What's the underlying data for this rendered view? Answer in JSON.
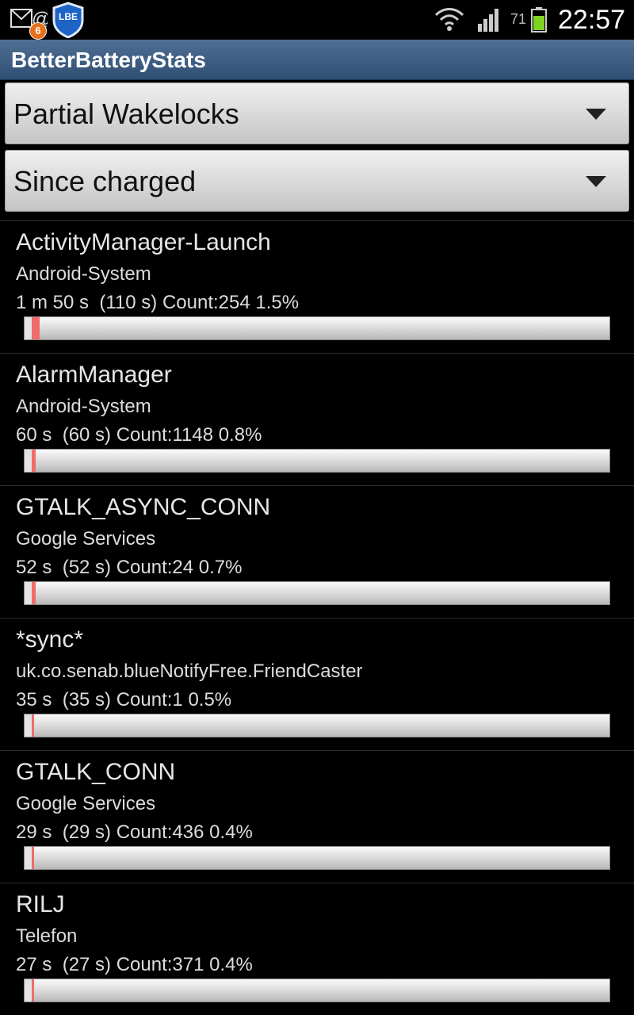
{
  "status_bar": {
    "notification_count": "6",
    "app_icon_text": "LBE",
    "battery_percent": "71",
    "time": "22:57",
    "icons": [
      "mail-icon",
      "lbe-shield-icon",
      "wifi-icon",
      "signal-icon",
      "battery-icon"
    ]
  },
  "app": {
    "title": "BetterBatteryStats"
  },
  "filters": {
    "stat_type": "Partial Wakelocks",
    "time_range": "Since charged"
  },
  "colors": {
    "title_bar": "#3e5f86",
    "bar_fill": "#f26a6a",
    "battery_green": "#7ed321"
  },
  "wakelocks": [
    {
      "name": "ActivityManager-Launch",
      "package": "Android-System",
      "stats": "1 m 50 s  (110 s) Count:254 1.5%",
      "percent": 1.5
    },
    {
      "name": "AlarmManager",
      "package": "Android-System",
      "stats": "60 s  (60 s) Count:1148 0.8%",
      "percent": 0.8
    },
    {
      "name": "GTALK_ASYNC_CONN",
      "package": "Google Services",
      "stats": "52 s  (52 s) Count:24 0.7%",
      "percent": 0.7
    },
    {
      "name": "*sync*",
      "package": "uk.co.senab.blueNotifyFree.FriendCaster",
      "stats": "35 s  (35 s) Count:1 0.5%",
      "percent": 0.5
    },
    {
      "name": "GTALK_CONN",
      "package": "Google Services",
      "stats": "29 s  (29 s) Count:436 0.4%",
      "percent": 0.4
    },
    {
      "name": "RILJ",
      "package": "Telefon",
      "stats": "27 s  (27 s) Count:371 0.4%",
      "percent": 0.4
    }
  ]
}
